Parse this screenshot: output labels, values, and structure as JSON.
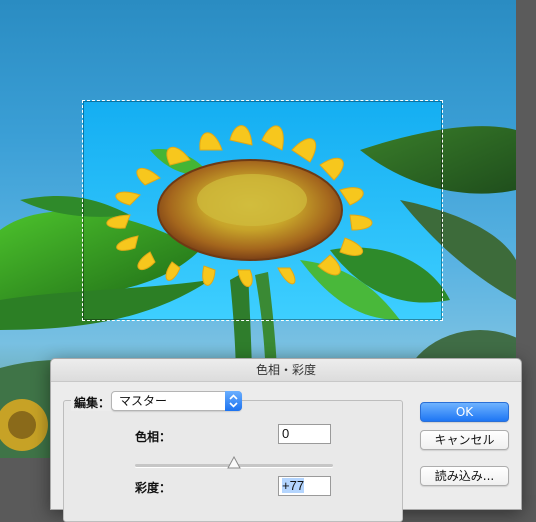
{
  "dialog": {
    "title": "色相・彩度",
    "edit_label": "編集：",
    "edit_value": "マスター",
    "hue_label": "色相：",
    "hue_value": "0",
    "hue_level": 0.5,
    "saturation_label": "彩度：",
    "saturation_value": "+77"
  },
  "buttons": {
    "ok": "OK",
    "cancel": "キャンセル",
    "load": "読み込み..."
  },
  "colors": {
    "accent": "#1e76f4",
    "selection_highlight": "#b4d5fe"
  },
  "icons": {
    "select_stepper": "up-down-chevron-icon",
    "slider_thumb": "triangle-thumb-icon"
  }
}
